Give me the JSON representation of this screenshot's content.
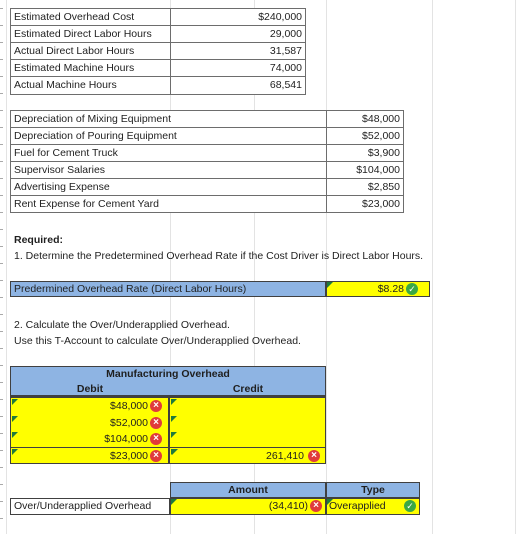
{
  "inputs_table": [
    {
      "label": "Estimated Overhead Cost",
      "value": "$240,000"
    },
    {
      "label": "Estimated Direct Labor Hours",
      "value": "29,000"
    },
    {
      "label": "Actual Direct Labor Hours",
      "value": "31,587"
    },
    {
      "label": "Estimated Machine Hours",
      "value": "74,000"
    },
    {
      "label": "Actual Machine Hours",
      "value": "68,541"
    }
  ],
  "overhead_table": [
    {
      "label": "Depreciation of Mixing Equipment",
      "value": "$48,000"
    },
    {
      "label": "Depreciation of Pouring Equipment",
      "value": "$52,000"
    },
    {
      "label": "Fuel for Cement Truck",
      "value": "$3,900"
    },
    {
      "label": "Supervisor Salaries",
      "value": "$104,000"
    },
    {
      "label": "Advertising Expense",
      "value": "$2,850"
    },
    {
      "label": "Rent Expense for Cement Yard",
      "value": "$23,000"
    }
  ],
  "required": {
    "heading": "Required:",
    "q1": "1. Determine the Predetermined Overhead Rate if the Cost Driver is Direct Labor Hours.",
    "pohr_label": "Predermined Overhead Rate (Direct Labor Hours)",
    "pohr_value": "$8.28",
    "q2": "2. Calculate the Over/Underapplied Overhead.",
    "q2_note": "Use this T-Account to calculate Over/Underapplied Overhead."
  },
  "t_account": {
    "title": "Manufacturing Overhead",
    "debit_header": "Debit",
    "credit_header": "Credit",
    "debits": [
      "$48,000",
      "$52,000",
      "$104,000",
      "$23,000"
    ],
    "credit_value": "261,410"
  },
  "result": {
    "amount_header": "Amount",
    "type_header": "Type",
    "label": "Over/Underapplied Overhead",
    "amount": "(34,410)",
    "type": "Overapplied"
  },
  "icons": {
    "incorrect": "x-circle-icon",
    "correct": "check-circle-icon",
    "flag": "comment-flag-icon"
  },
  "colors": {
    "input_blue": "#8eb4e3",
    "answer_yellow": "#ffff00",
    "incorrect_red": "#e03b3b",
    "correct_green": "#3aa845"
  }
}
